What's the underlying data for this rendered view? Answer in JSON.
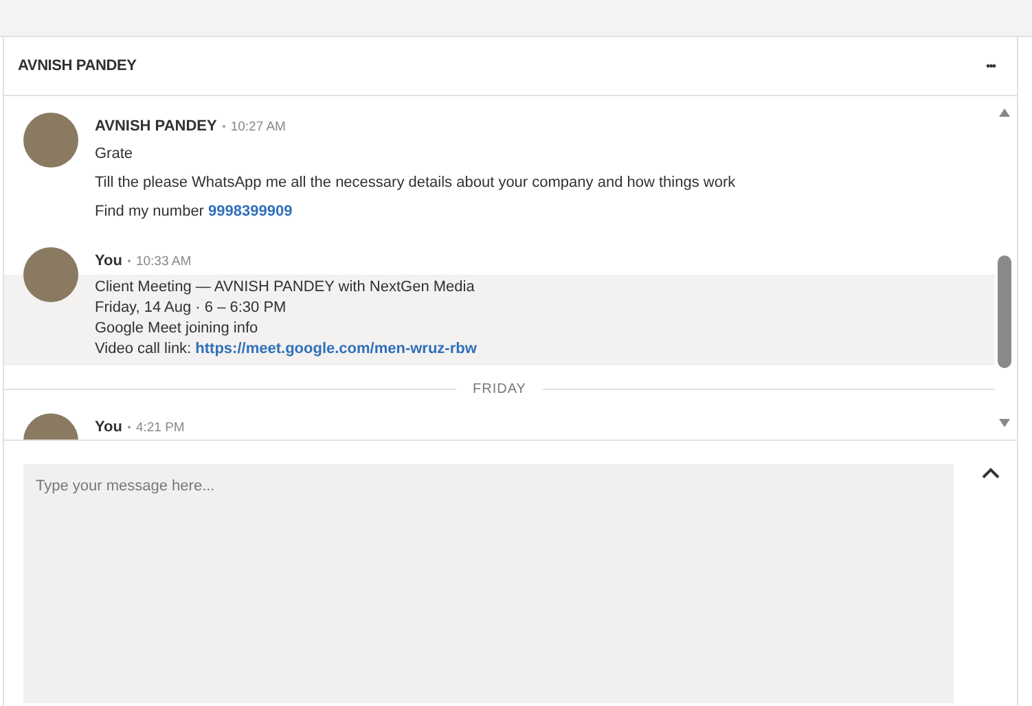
{
  "header": {
    "title": "AVNISH PANDEY",
    "menu": "•••"
  },
  "messages": [
    {
      "sender": "AVNISH PANDEY",
      "time": "10:27 AM",
      "highlighted": false,
      "lines": [
        {
          "text": "Grate"
        },
        {
          "text": "Till the please WhatsApp me all the necessary details about your company and how things work"
        },
        {
          "text": "Find my number ",
          "link": "9998399909"
        }
      ]
    },
    {
      "sender": "You",
      "time": "10:33 AM",
      "highlighted": true,
      "lines": [
        {
          "text": "Client Meeting — AVNISH PANDEY with NextGen Media"
        },
        {
          "text": "Friday, 14 Aug · 6 – 6:30 PM"
        },
        {
          "text": "Google Meet joining info"
        },
        {
          "text": "Video call link: ",
          "link": "https://meet.google.com/men-wruz-rbw"
        }
      ]
    },
    {
      "kind": "divider",
      "label": "FRIDAY"
    },
    {
      "sender": "You",
      "time": "4:21 PM",
      "highlighted": false
    }
  ],
  "compose": {
    "placeholder": "Type your message here..."
  }
}
